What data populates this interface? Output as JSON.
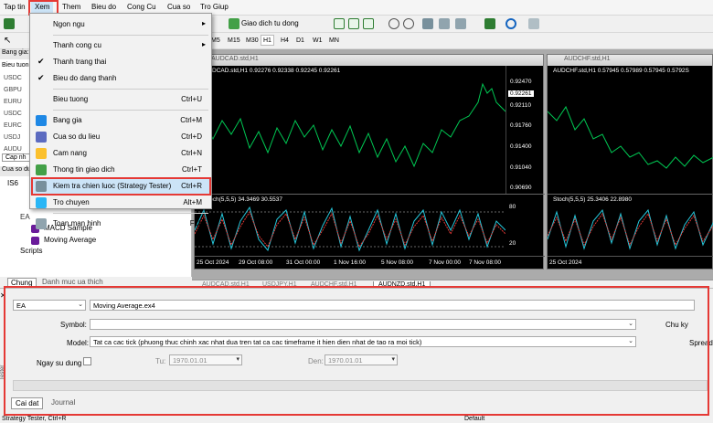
{
  "menu": {
    "items": [
      "Tap tin",
      "Xem",
      "Them",
      "Bieu do",
      "Cong Cu",
      "Cua so",
      "Tro Giup"
    ]
  },
  "toolbar": {
    "autotrade_label": "Giao dich tu dong",
    "timeframes": [
      "M5",
      "M15",
      "M30",
      "H1",
      "H4",
      "D1",
      "W1",
      "MN"
    ],
    "active_tf": "H1"
  },
  "left_panel": {
    "market_watch_title": "Bang gia:",
    "market_watch_col": "Bieu tuong",
    "symbols_visible": [
      "USDC",
      "GBPU",
      "EURU",
      "USDC",
      "EURC",
      "USDJ",
      "AUDU"
    ],
    "tabs_small": [
      "Cap nh"
    ],
    "navigator_title": "Cua so du",
    "navigator_tree": [
      "IS6",
      "EA",
      "MACD Sample",
      "Moving Average",
      "Scripts"
    ],
    "bottom_tabs": [
      "Chung",
      "Danh muc ua thich"
    ]
  },
  "chart1": {
    "title": "AUDCAD.std,H1",
    "info": "AUDCAD.std,H1  0.92276 0.92338 0.92245 0.92261",
    "prices": [
      "0.92470",
      "0.92261",
      "0.92110",
      "0.91760",
      "0.91400",
      "0.91040",
      "0.90690"
    ],
    "price_highlight": "0.92261",
    "osc_info": "Stoch(5,5,5) 34.3469 30.5537",
    "osc_levels": [
      "80",
      "20"
    ],
    "dates": [
      "25 Oct 2024",
      "29 Oct 08:00",
      "31 Oct 00:00",
      "1 Nov 16:00",
      "5 Nov 08:00",
      "7 Nov 00:00",
      "7 Nov 08:00"
    ]
  },
  "chart2": {
    "title": "AUDCHF.std,H1",
    "info": "AUDCHF.std,H1  0.57945 0.57989 0.57945 0.5792S",
    "osc_info": "Stoch(5,5,5) 25.3406 22.8980",
    "dates": [
      "25 Oct 2024"
    ]
  },
  "chart_tabs": [
    "AUDCAD.std,H1",
    "USDJPY,H1",
    "AUDCHF.std,H1",
    "AUDNZD.std,H1"
  ],
  "chart_tab_active": "AUDNZD.std,H1",
  "tester": {
    "type": "EA",
    "expert": "Moving Average.ex4",
    "symbol_label": "Symbol:",
    "symbol_value": "",
    "model_label": "Model:",
    "model_value": "Tat ca cac tick (phuong thuc chinh xac nhat dua tren tat ca cac timeframe it hien dien nhat de tao ra moi tick)",
    "use_date_label": "Ngay su dung",
    "from_label": "Tu:",
    "from_value": "1970.01.01",
    "to_label": "Den:",
    "to_value": "1970.01.01",
    "right_label1": "Chu ky",
    "right_label2": "Spread",
    "tabs": [
      "Cai dat",
      "Journal"
    ],
    "side_title": "Tester"
  },
  "status": {
    "left": "Strategy Tester, Ctrl+R",
    "mid": "Default"
  },
  "dropdown": {
    "items": [
      {
        "label": "Ngon ngu",
        "shortcut": "",
        "submenu": true,
        "check": false,
        "icon": ""
      },
      {
        "sep": true
      },
      {
        "label": "Thanh cong cu",
        "shortcut": "",
        "submenu": true,
        "check": false,
        "icon": ""
      },
      {
        "label": "Thanh trang thai",
        "shortcut": "",
        "submenu": false,
        "check": true,
        "icon": ""
      },
      {
        "label": "Bieu do dang thanh",
        "shortcut": "",
        "submenu": false,
        "check": true,
        "icon": ""
      },
      {
        "sep": true
      },
      {
        "label": "Bieu tuong",
        "shortcut": "Ctrl+U",
        "submenu": false,
        "check": false,
        "icon": ""
      },
      {
        "sep": true
      },
      {
        "label": "Bang gia",
        "shortcut": "Ctrl+M",
        "submenu": false,
        "check": false,
        "icon": "market-watch-icon"
      },
      {
        "label": "Cua so du lieu",
        "shortcut": "Ctrl+D",
        "submenu": false,
        "check": false,
        "icon": "data-window-icon"
      },
      {
        "label": "Cam nang",
        "shortcut": "Ctrl+N",
        "submenu": false,
        "check": false,
        "icon": "navigator-icon"
      },
      {
        "label": "Thong tin giao dich",
        "shortcut": "Ctrl+T",
        "submenu": false,
        "check": false,
        "icon": "terminal-icon"
      },
      {
        "label": "Kiem tra chien luoc (Strategy Tester)",
        "shortcut": "Ctrl+R",
        "submenu": false,
        "check": false,
        "icon": "strategy-tester-icon",
        "highlight": true
      },
      {
        "label": "Tro chuyen",
        "shortcut": "Alt+M",
        "submenu": false,
        "check": false,
        "icon": "chat-icon"
      },
      {
        "sep": true
      },
      {
        "label": "Toan man hinh",
        "shortcut": "F11",
        "submenu": false,
        "check": false,
        "icon": "fullscreen-icon"
      }
    ]
  },
  "colors": {
    "accent": "#e53935",
    "highlight": "#cce4f7",
    "bull": "#00c853",
    "chart_bg": "#000000"
  }
}
